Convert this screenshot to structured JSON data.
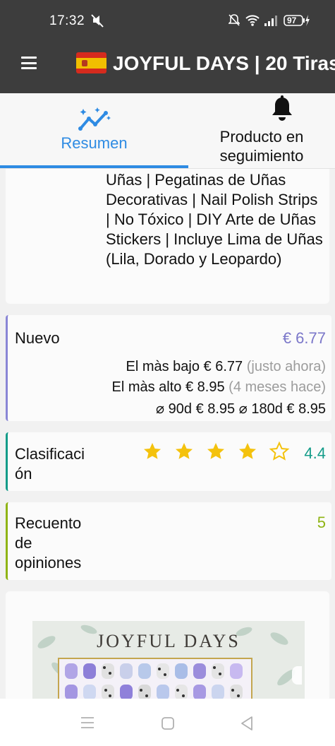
{
  "status": {
    "time": "17:32",
    "battery": "97"
  },
  "appbar": {
    "title": "JOYFUL DAYS | 20 Tiras"
  },
  "tabs": [
    {
      "label": "Resumen",
      "icon": "insights-icon",
      "active": true
    },
    {
      "label": "Producto en seguimiento",
      "icon": "bell-icon",
      "active": false
    }
  ],
  "product": {
    "title_text": "Uñas | Pegatinas de Uñas Decorativas | Nail Polish Strips | No Tóxico | DIY Arte de Uñas Stickers | Incluye Lima de Uñas (Lila, Dorado y Leopardo)"
  },
  "price": {
    "label": "Nuevo",
    "current": "€ 6.77",
    "lowest_label": "El màs bajo",
    "lowest_value": "€ 6.77",
    "lowest_when": "(justo ahora)",
    "highest_label": "El màs alto",
    "highest_value": "€ 8.95",
    "highest_when": "(4 meses hace)",
    "avg90_label": "⌀ 90d",
    "avg90_value": "€ 8.95",
    "avg180_label": "⌀ 180d",
    "avg180_value": "€ 8.95"
  },
  "rating": {
    "label_line1": "Clasificaci",
    "label_line2": "ón",
    "value": "4.4",
    "stars": 4.4
  },
  "reviews": {
    "label_line1": "Recuento",
    "label_line2": "de",
    "label_line3": "opiniones",
    "value": "5"
  },
  "image": {
    "brand_text": "JOYFUL DAYS"
  },
  "colors": {
    "accent_blue": "#2e8be3",
    "price_purple": "#7b77c9",
    "rating_teal": "#139c89",
    "reviews_green": "#8fb414",
    "star_gold": "#f4c20d",
    "bar_dark": "#3d3d3d"
  }
}
